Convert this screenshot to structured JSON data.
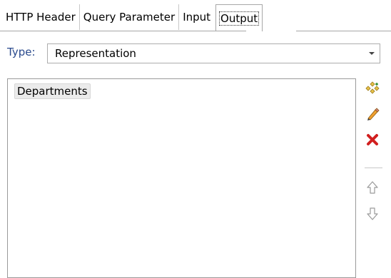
{
  "tabs": [
    {
      "label": "HTTP Header"
    },
    {
      "label": "Query Parameter"
    },
    {
      "label": "Input"
    },
    {
      "label": "Output",
      "selected": true
    }
  ],
  "type_field": {
    "label": "Type:",
    "value": "Representation"
  },
  "list": {
    "items": [
      {
        "label": "Departments"
      }
    ]
  },
  "toolbar": {
    "icons": [
      "add-icon",
      "edit-pencil-icon",
      "delete-x-icon",
      "move-up-icon",
      "move-down-icon"
    ]
  },
  "colors": {
    "type_label": "#2a4a8d",
    "delete": "#d11f1f",
    "pencil": "#e0931e",
    "add": "#e2b43a"
  }
}
